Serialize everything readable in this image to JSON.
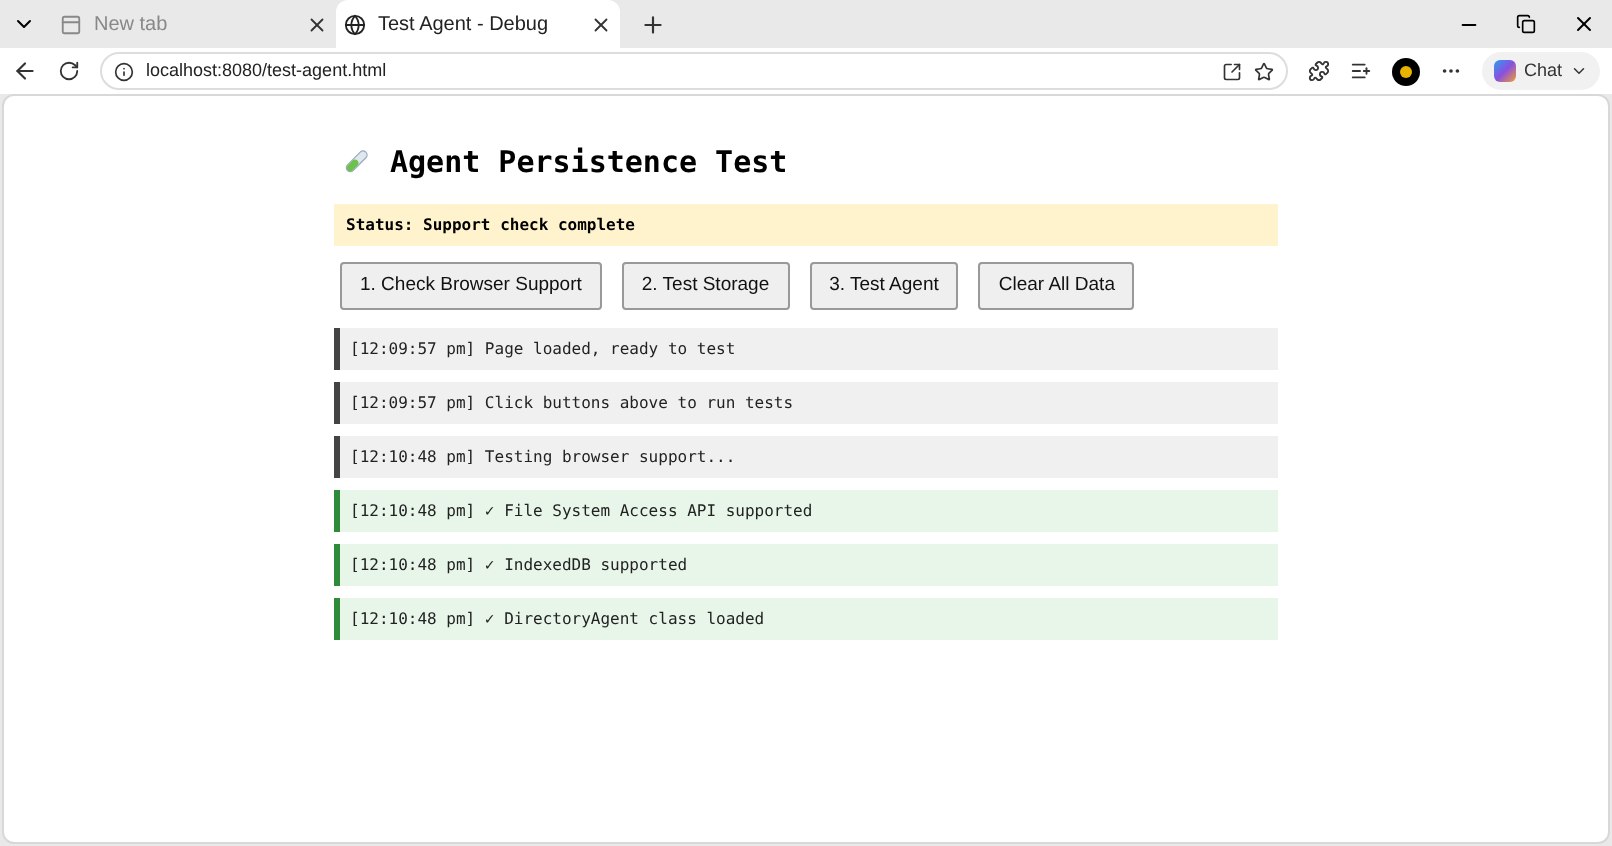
{
  "tabs": [
    {
      "title": "New tab",
      "selected": false
    },
    {
      "title": "Test Agent - Debug",
      "selected": true
    }
  ],
  "address_bar": {
    "url": "localhost:8080/test-agent.html"
  },
  "chat_button": {
    "label": "Chat"
  },
  "page": {
    "title": "Agent Persistence Test",
    "status": "Status: Support check complete",
    "buttons": [
      "1. Check Browser Support",
      "2. Test Storage",
      "3. Test Agent",
      "Clear All Data"
    ],
    "log": [
      {
        "kind": "info",
        "text": "[12:09:57 pm] Page loaded, ready to test"
      },
      {
        "kind": "info",
        "text": "[12:09:57 pm] Click buttons above to run tests"
      },
      {
        "kind": "info",
        "text": "[12:10:48 pm] Testing browser support..."
      },
      {
        "kind": "success",
        "text": "[12:10:48 pm] ✓ File System Access API supported"
      },
      {
        "kind": "success",
        "text": "[12:10:48 pm] ✓ IndexedDB supported"
      },
      {
        "kind": "success",
        "text": "[12:10:48 pm] ✓ DirectoryAgent class loaded"
      }
    ]
  }
}
